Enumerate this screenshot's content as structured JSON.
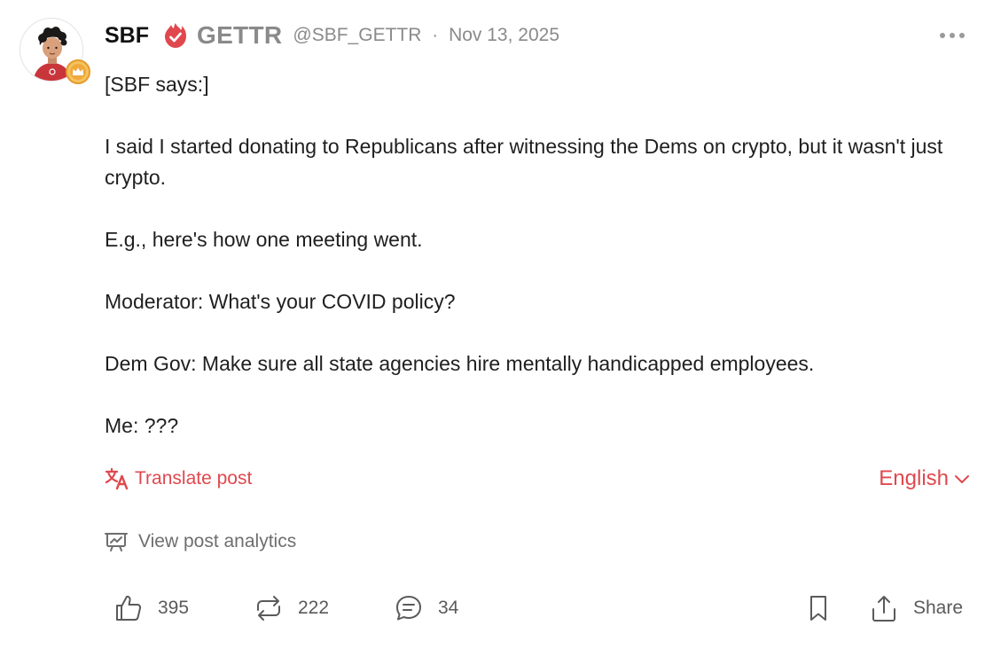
{
  "author": {
    "display_name": "SBF",
    "brand": "GETTR",
    "handle": "@SBF_GETTR",
    "separator": "·",
    "date": "Nov 13, 2025"
  },
  "post": {
    "lines": [
      "[SBF says:]",
      "",
      "I said I started donating to Republicans after witnessing the Dems on crypto, but it wasn't just crypto.",
      "",
      "E.g., here's how one meeting went.",
      "",
      "Moderator: What's your COVID policy?",
      "",
      "Dem Gov: Make sure all state agencies hire mentally handicapped employees.",
      "",
      "Me: ???"
    ]
  },
  "translate": {
    "label": "Translate post",
    "language": "English"
  },
  "analytics": {
    "label": "View post analytics"
  },
  "actions": {
    "likes": "395",
    "reposts": "222",
    "comments": "34",
    "share_label": "Share"
  },
  "colors": {
    "accent": "#e0484e",
    "muted": "#8a8a8a",
    "crown_badge": "#f0a93b"
  },
  "icons": [
    "avatar",
    "crown-badge-icon",
    "verified-icon",
    "more-icon",
    "translate-icon",
    "chevron-down-icon",
    "analytics-icon",
    "like-icon",
    "repost-icon",
    "comment-icon",
    "bookmark-icon",
    "share-icon"
  ]
}
